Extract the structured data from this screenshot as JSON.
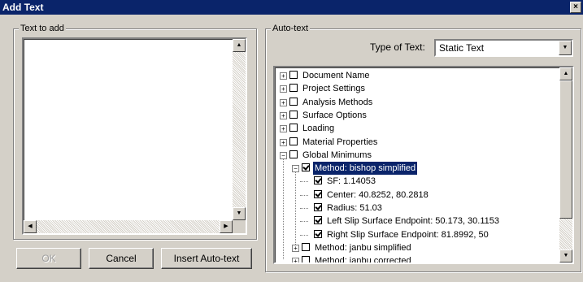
{
  "window": {
    "title": "Add Text",
    "close_glyph": "×"
  },
  "text_to_add": {
    "label": "Text to add",
    "value": ""
  },
  "buttons": {
    "ok": "OK",
    "cancel": "Cancel",
    "insert_auto_text": "Insert Auto-text"
  },
  "auto_text": {
    "label": "Auto-text",
    "type_label": "Type of Text:",
    "type_value": "Static Text",
    "tree": [
      {
        "label": "Document Name",
        "checked": false,
        "expander": "+"
      },
      {
        "label": "Project Settings",
        "checked": false,
        "expander": "+"
      },
      {
        "label": "Analysis Methods",
        "checked": false,
        "expander": "+"
      },
      {
        "label": "Surface Options",
        "checked": false,
        "expander": "+"
      },
      {
        "label": "Loading",
        "checked": false,
        "expander": "+"
      },
      {
        "label": "Material Properties",
        "checked": false,
        "expander": "+"
      },
      {
        "label": "Global Minimums",
        "checked": false,
        "expander": "-"
      },
      {
        "label": "Method: bishop simplified",
        "checked": true,
        "expander": "-",
        "selected": true
      },
      {
        "label": "SF: 1.14053",
        "checked": true
      },
      {
        "label": "Center: 40.8252, 80.2818",
        "checked": true
      },
      {
        "label": "Radius: 51.03",
        "checked": true
      },
      {
        "label": "Left Slip Surface Endpoint: 50.173, 30.1153",
        "checked": true
      },
      {
        "label": "Right Slip Surface Endpoint: 81.8992, 50",
        "checked": true
      },
      {
        "label": "Method: janbu simplified",
        "checked": false,
        "expander": "+"
      },
      {
        "label": "Method: janbu corrected",
        "checked": false,
        "expander": "+"
      }
    ]
  }
}
